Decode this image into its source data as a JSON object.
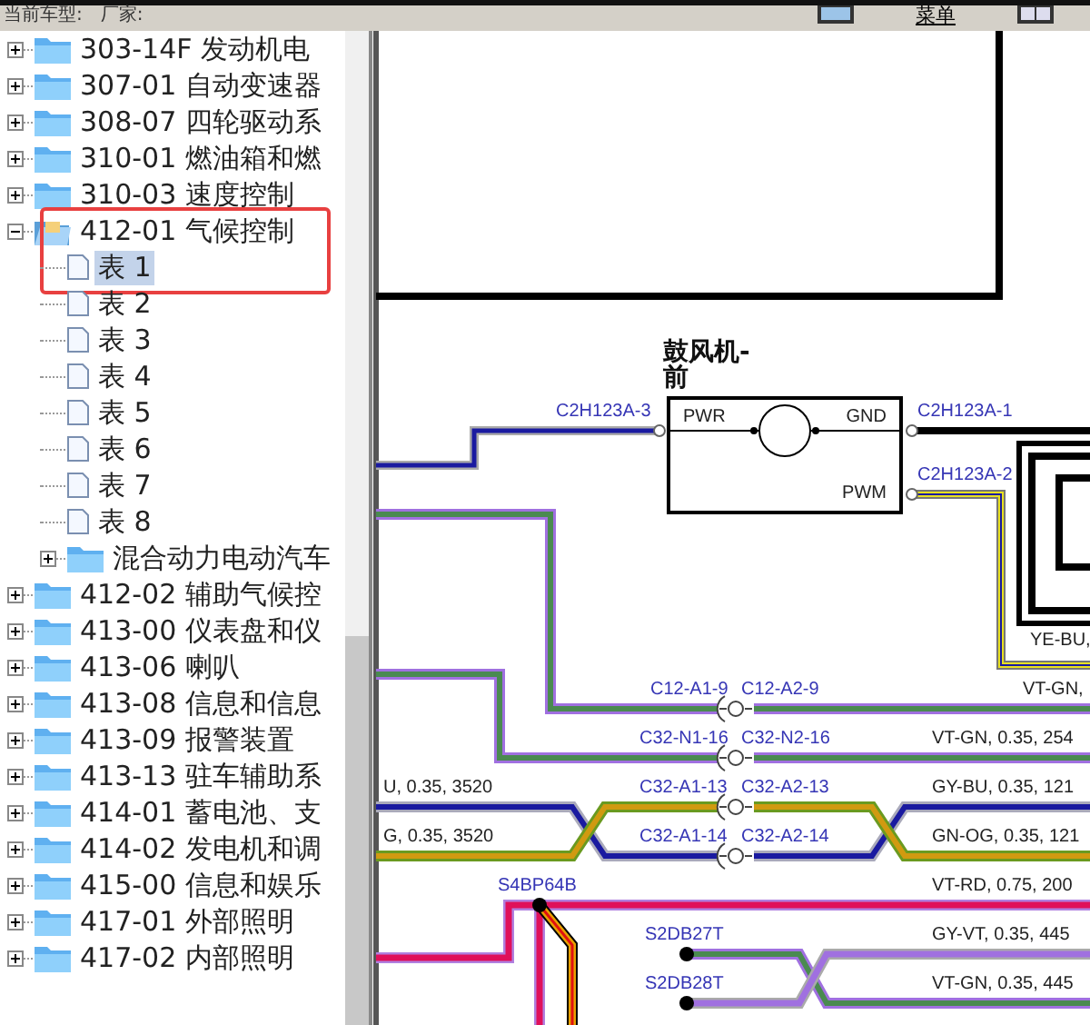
{
  "toolbar": {
    "labels": [
      "当前车型:",
      "厂家:"
    ],
    "menu_label": "菜单"
  },
  "tree": [
    {
      "label": "303-14F 发动机电",
      "kind": "folder",
      "expanded": false,
      "selected": false
    },
    {
      "label": "307-01 自动变速器",
      "kind": "folder",
      "expanded": false,
      "selected": false
    },
    {
      "label": "308-07 四轮驱动系",
      "kind": "folder",
      "expanded": false,
      "selected": false
    },
    {
      "label": "310-01 燃油箱和燃",
      "kind": "folder",
      "expanded": false,
      "selected": false
    },
    {
      "label": "310-03 速度控制",
      "kind": "folder",
      "expanded": false,
      "selected": false
    },
    {
      "label": "412-01 气候控制",
      "kind": "folder",
      "expanded": true,
      "selected": false,
      "highlighted": true,
      "children": [
        {
          "label": "表 1",
          "kind": "page",
          "selected": true
        },
        {
          "label": "表 2",
          "kind": "page",
          "selected": false
        },
        {
          "label": "表 3",
          "kind": "page",
          "selected": false
        },
        {
          "label": "表 4",
          "kind": "page",
          "selected": false
        },
        {
          "label": "表 5",
          "kind": "page",
          "selected": false
        },
        {
          "label": "表 6",
          "kind": "page",
          "selected": false
        },
        {
          "label": "表 7",
          "kind": "page",
          "selected": false
        },
        {
          "label": "表 8",
          "kind": "page",
          "selected": false
        },
        {
          "label": "混合动力电动汽车",
          "kind": "folder",
          "expanded": false,
          "selected": false
        }
      ]
    },
    {
      "label": "412-02 辅助气候控",
      "kind": "folder",
      "expanded": false,
      "selected": false
    },
    {
      "label": "413-00 仪表盘和仪",
      "kind": "folder",
      "expanded": false,
      "selected": false
    },
    {
      "label": "413-06 喇叭",
      "kind": "folder",
      "expanded": false,
      "selected": false
    },
    {
      "label": "413-08 信息和信息",
      "kind": "folder",
      "expanded": false,
      "selected": false
    },
    {
      "label": "413-09 报警装置",
      "kind": "folder",
      "expanded": false,
      "selected": false
    },
    {
      "label": "413-13 驻车辅助系",
      "kind": "folder",
      "expanded": false,
      "selected": false
    },
    {
      "label": "414-01 蓄电池、支",
      "kind": "folder",
      "expanded": false,
      "selected": false
    },
    {
      "label": "414-02 发电机和调",
      "kind": "folder",
      "expanded": false,
      "selected": false
    },
    {
      "label": "415-00 信息和娱乐",
      "kind": "folder",
      "expanded": false,
      "selected": false
    },
    {
      "label": "417-01 外部照明",
      "kind": "folder",
      "expanded": false,
      "selected": false
    },
    {
      "label": "417-02 内部照明",
      "kind": "folder",
      "expanded": false,
      "selected": false
    }
  ],
  "diagram": {
    "component": {
      "title": "鼓风机-前",
      "pins": [
        "PWR",
        "GND",
        "PWM"
      ]
    },
    "connector_labels": [
      "C2H123A-3",
      "C2H123A-1",
      "C2H123A-2",
      "C12-A1-9",
      "C12-A2-9",
      "C32-N1-16",
      "C32-N2-16",
      "C32-A1-13",
      "C32-A2-13",
      "C32-A1-14",
      "C32-A2-14",
      "S4BP64B",
      "S2DB27T",
      "S2DB28T"
    ],
    "wire_labels": [
      "YE-BU,",
      "VT-GN,",
      "VT-GN, 0.35, 254",
      "U, 0.35, 3520",
      "GY-BU, 0.35, 121",
      "G, 0.35, 3520",
      "GN-OG, 0.35, 121",
      "VT-RD, 0.75, 200",
      "GY-VT, 0.35, 445",
      "VT-GN, 0.35, 445"
    ]
  }
}
